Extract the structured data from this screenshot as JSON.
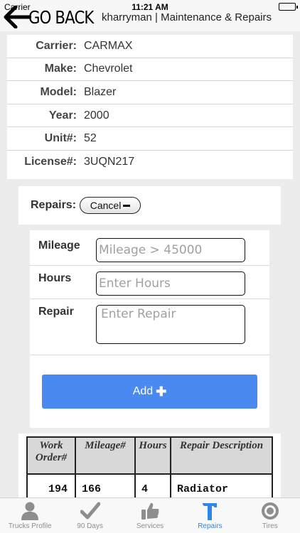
{
  "status_bar": {
    "carrier": "Carrier",
    "time": "11:21 AM"
  },
  "nav": {
    "back_label": "GO BACK",
    "title": "kharryman | Maintenance & Repairs"
  },
  "vehicle_info": [
    {
      "label": "Carrier:",
      "value": "CARMAX"
    },
    {
      "label": "Make:",
      "value": "Chevrolet"
    },
    {
      "label": "Model:",
      "value": "Blazer"
    },
    {
      "label": "Year:",
      "value": "2000"
    },
    {
      "label": "Unit#:",
      "value": "52"
    },
    {
      "label": "License#:",
      "value": "3UQN217"
    }
  ],
  "repairs": {
    "label": "Repairs:",
    "cancel_label": "Cancel"
  },
  "form": {
    "mileage": {
      "label": "Mileage",
      "placeholder": "Mileage > 45000",
      "value": ""
    },
    "hours": {
      "label": "Hours",
      "placeholder": "Enter Hours",
      "value": ""
    },
    "repair": {
      "label": "Repair",
      "placeholder": "Enter Repair",
      "value": ""
    },
    "add_label": "Add"
  },
  "table": {
    "headers": [
      "Work Order#",
      "Mileage#",
      "Hours",
      "Repair Description"
    ],
    "rows": [
      {
        "work_order": "194",
        "mileage": "166",
        "hours": "4",
        "description": "Radiator"
      }
    ]
  },
  "tabbar": {
    "tabs": [
      {
        "label": "Trucks Profile",
        "icon": "user-icon"
      },
      {
        "label": "90 Days",
        "icon": "checkmark-icon"
      },
      {
        "label": "Services",
        "icon": "thumbs-up-icon"
      },
      {
        "label": "Repairs",
        "icon": "hammer-icon"
      },
      {
        "label": "Tires",
        "icon": "tire-icon"
      }
    ],
    "active_tab": "Repairs",
    "active_color": "#2f86e6",
    "inactive_color": "#8e8e8e"
  },
  "colors": {
    "add_button": "#4a8af0"
  }
}
